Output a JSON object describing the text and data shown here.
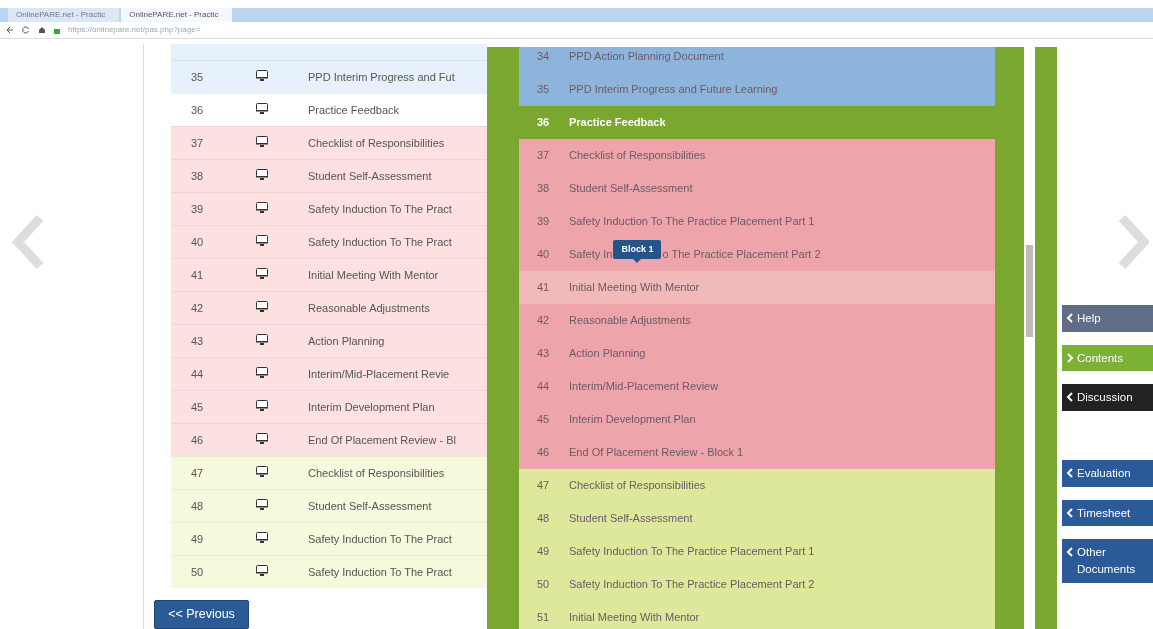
{
  "browser": {
    "tabs": [
      {
        "title": "OnlinePARE.net - Practic",
        "selected": false
      },
      {
        "title": "OnlinePARE.net - Practic",
        "selected": true
      }
    ],
    "url": "https://onlinepare.net/pas.php?page="
  },
  "table": {
    "rows": [
      {
        "number": "35",
        "title": "PPD Interim Progress and Fut",
        "color": "#e6f1fb"
      },
      {
        "number": "36",
        "title": "Practice Feedback",
        "color": "#ffffff"
      },
      {
        "number": "37",
        "title": "Checklist of Responsibilities",
        "color": "#fde0e0"
      },
      {
        "number": "38",
        "title": "Student Self-Assessment",
        "color": "#fde0e0"
      },
      {
        "number": "39",
        "title": "Safety Induction To The Pract",
        "color": "#fde0e0"
      },
      {
        "number": "40",
        "title": "Safety Induction To The Pract",
        "color": "#fde0e0"
      },
      {
        "number": "41",
        "title": "Initial Meeting With Mentor",
        "color": "#fde0e0"
      },
      {
        "number": "42",
        "title": "Reasonable Adjustments",
        "color": "#fde0e0"
      },
      {
        "number": "43",
        "title": "Action Planning",
        "color": "#fde0e0"
      },
      {
        "number": "44",
        "title": "Interim/Mid-Placement Revie",
        "color": "#fde0e0"
      },
      {
        "number": "45",
        "title": "Interim Development Plan",
        "color": "#fde0e0"
      },
      {
        "number": "46",
        "title": "End Of Placement Review - Bl",
        "color": "#fde0e0"
      },
      {
        "number": "47",
        "title": "Checklist of Responsibilities",
        "color": "#f6f9dc"
      },
      {
        "number": "48",
        "title": "Student Self-Assessment",
        "color": "#f6f9dc"
      },
      {
        "number": "49",
        "title": "Safety Induction To The Pract",
        "color": "#f6f9dc"
      },
      {
        "number": "50",
        "title": "Safety Induction To The Pract",
        "color": "#f6f9dc"
      }
    ]
  },
  "previous_button": "<< Previous",
  "contents_panel": {
    "items": [
      {
        "number": "34",
        "title": "PPD Action Planning Document",
        "color": "#8db5dc",
        "selected": false,
        "hovered": false
      },
      {
        "number": "35",
        "title": "PPD Interim Progress and Future Learning",
        "color": "#8db5dc",
        "selected": false,
        "hovered": false
      },
      {
        "number": "36",
        "title": "Practice Feedback",
        "color": "#79a72f",
        "selected": true,
        "hovered": false
      },
      {
        "number": "37",
        "title": "Checklist of Responsibilities",
        "color": "#eda4aa",
        "selected": false,
        "hovered": false
      },
      {
        "number": "38",
        "title": "Student Self-Assessment",
        "color": "#eda4aa",
        "selected": false,
        "hovered": false
      },
      {
        "number": "39",
        "title": "Safety Induction To The Practice Placement Part 1",
        "color": "#eda4aa",
        "selected": false,
        "hovered": false
      },
      {
        "number": "40",
        "title": "Safety In",
        "tooltip": "Block 1",
        "title_after_tooltip": "o The Practice Placement Part 2",
        "color": "#eda4aa",
        "selected": false,
        "hovered": false
      },
      {
        "number": "41",
        "title": "Initial Meeting With Mentor",
        "color": "#f2b9bb",
        "selected": false,
        "hovered": false
      },
      {
        "number": "42",
        "title": "Reasonable Adjustments",
        "color": "#eda4aa",
        "selected": false,
        "hovered": false
      },
      {
        "number": "43",
        "title": "Action Planning",
        "color": "#eda4aa",
        "selected": false,
        "hovered": false
      },
      {
        "number": "44",
        "title": "Interim/Mid-Placement Review",
        "color": "#eda4aa",
        "selected": false,
        "hovered": false
      },
      {
        "number": "45",
        "title": "Interim Development Plan",
        "color": "#eda4aa",
        "selected": false,
        "hovered": false
      },
      {
        "number": "46",
        "title": "End Of Placement Review - Block 1",
        "color": "#eda4aa",
        "selected": false,
        "hovered": false
      },
      {
        "number": "47",
        "title": "Checklist of Responsibilities",
        "color": "#dde89a",
        "selected": false,
        "hovered": false
      },
      {
        "number": "48",
        "title": "Student Self-Assessment",
        "color": "#dde89a",
        "selected": false,
        "hovered": false
      },
      {
        "number": "49",
        "title": "Safety Induction To The Practice Placement Part 1",
        "color": "#dde89a",
        "selected": false,
        "hovered": false
      },
      {
        "number": "50",
        "title": "Safety Induction To The Practice Placement Part 2",
        "color": "#dde89a",
        "selected": false,
        "hovered": false
      },
      {
        "number": "51",
        "title": "Initial Meeting With Mentor",
        "color": "#dde89a",
        "selected": false,
        "hovered": false
      }
    ]
  },
  "side_buttons": [
    {
      "label": "Help",
      "kind": "help"
    },
    {
      "label": "Contents",
      "kind": "contents"
    },
    {
      "label": "Discussion",
      "kind": "discussion"
    },
    {
      "label": "Evaluation",
      "kind": "document"
    },
    {
      "label": "Timesheet",
      "kind": "document"
    },
    {
      "label": "Other Documents",
      "kind": "document"
    }
  ]
}
